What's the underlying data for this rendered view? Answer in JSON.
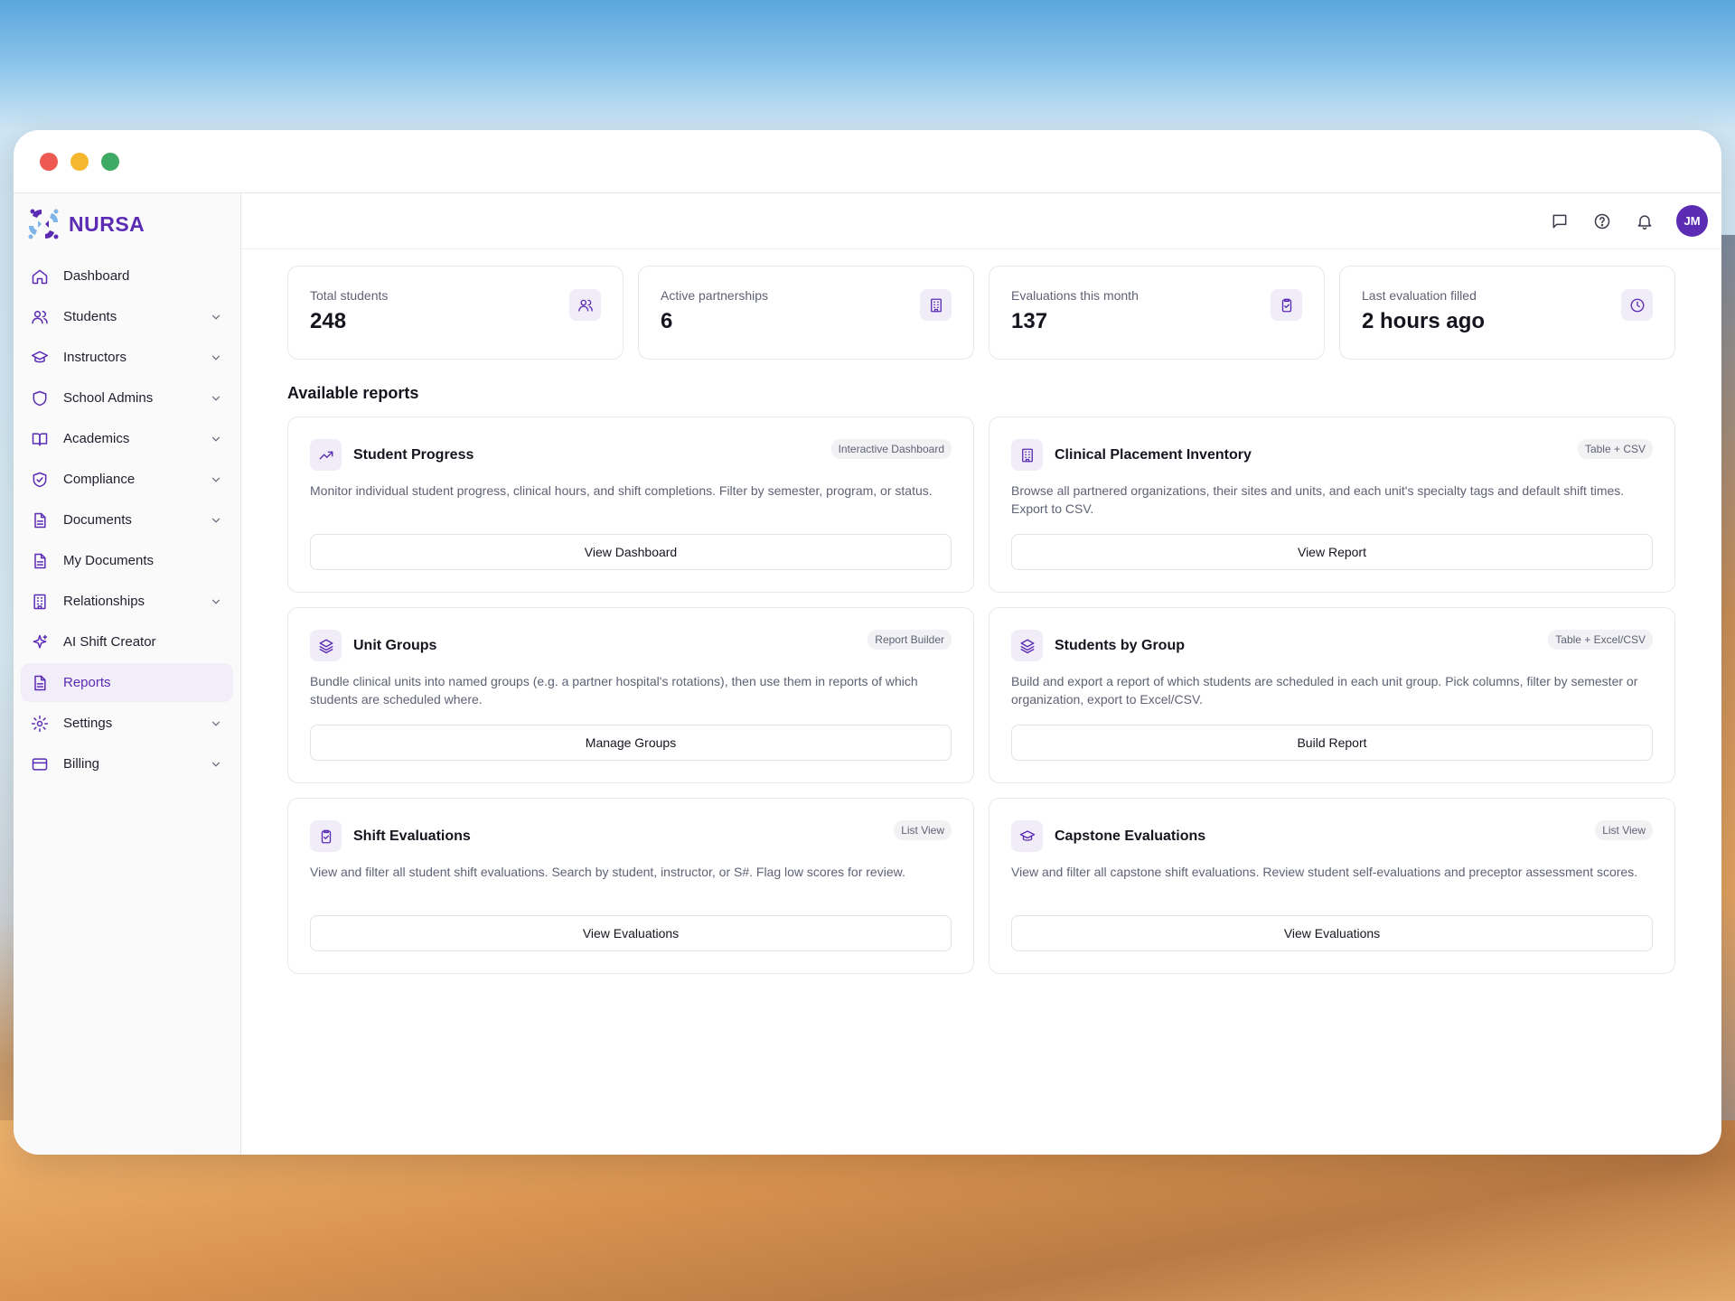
{
  "brand": {
    "name": "NURSA",
    "color": "#5b2bb3"
  },
  "sidebar": {
    "items": [
      {
        "label": "Dashboard",
        "icon": "home-icon",
        "expandable": false,
        "active": false
      },
      {
        "label": "Students",
        "icon": "users-icon",
        "expandable": true,
        "active": false
      },
      {
        "label": "Instructors",
        "icon": "graduation-cap-icon",
        "expandable": true,
        "active": false
      },
      {
        "label": "School Admins",
        "icon": "shield-icon",
        "expandable": true,
        "active": false
      },
      {
        "label": "Academics",
        "icon": "book-icon",
        "expandable": true,
        "active": false
      },
      {
        "label": "Compliance",
        "icon": "shield-check-icon",
        "expandable": true,
        "active": false
      },
      {
        "label": "Documents",
        "icon": "document-icon",
        "expandable": true,
        "active": false
      },
      {
        "label": "My Documents",
        "icon": "document-icon",
        "expandable": false,
        "active": false
      },
      {
        "label": "Relationships",
        "icon": "building-icon",
        "expandable": true,
        "active": false
      },
      {
        "label": "AI Shift Creator",
        "icon": "sparkles-icon",
        "expandable": false,
        "active": false
      },
      {
        "label": "Reports",
        "icon": "document-icon",
        "expandable": false,
        "active": true
      },
      {
        "label": "Settings",
        "icon": "gear-icon",
        "expandable": true,
        "active": false
      },
      {
        "label": "Billing",
        "icon": "credit-card-icon",
        "expandable": true,
        "active": false
      }
    ]
  },
  "topbar": {
    "avatar_initials": "JM"
  },
  "stats": [
    {
      "label": "Total students",
      "value": "248",
      "icon": "users-icon"
    },
    {
      "label": "Active partnerships",
      "value": "6",
      "icon": "building-icon"
    },
    {
      "label": "Evaluations this month",
      "value": "137",
      "icon": "clipboard-check-icon"
    },
    {
      "label": "Last evaluation filled",
      "value": "2 hours ago",
      "icon": "clock-icon"
    }
  ],
  "reports": {
    "title": "Available reports",
    "cards": [
      {
        "title": "Student Progress",
        "badge": "Interactive Dashboard",
        "desc": "Monitor individual student progress, clinical hours, and shift completions. Filter by semester, program, or status.",
        "button": "View Dashboard",
        "icon": "trending-up-icon"
      },
      {
        "title": "Clinical Placement Inventory",
        "badge": "Table + CSV",
        "desc": "Browse all partnered organizations, their sites and units, and each unit's specialty tags and default shift times. Export to CSV.",
        "button": "View Report",
        "icon": "building-icon"
      },
      {
        "title": "Unit Groups",
        "badge": "Report Builder",
        "desc": "Bundle clinical units into named groups (e.g. a partner hospital's rotations), then use them in reports of which students are scheduled where.",
        "button": "Manage Groups",
        "icon": "layers-icon"
      },
      {
        "title": "Students by Group",
        "badge": "Table + Excel/CSV",
        "desc": "Build and export a report of which students are scheduled in each unit group. Pick columns, filter by semester or organization, export to Excel/CSV.",
        "button": "Build Report",
        "icon": "layers-icon"
      },
      {
        "title": "Shift Evaluations",
        "badge": "List View",
        "desc": "View and filter all student shift evaluations. Search by student, instructor, or S#. Flag low scores for review.",
        "button": "View Evaluations",
        "icon": "clipboard-check-icon"
      },
      {
        "title": "Capstone Evaluations",
        "badge": "List View",
        "desc": "View and filter all capstone shift evaluations. Review student self-evaluations and preceptor assessment scores.",
        "button": "View Evaluations",
        "icon": "graduation-cap-icon"
      }
    ]
  }
}
